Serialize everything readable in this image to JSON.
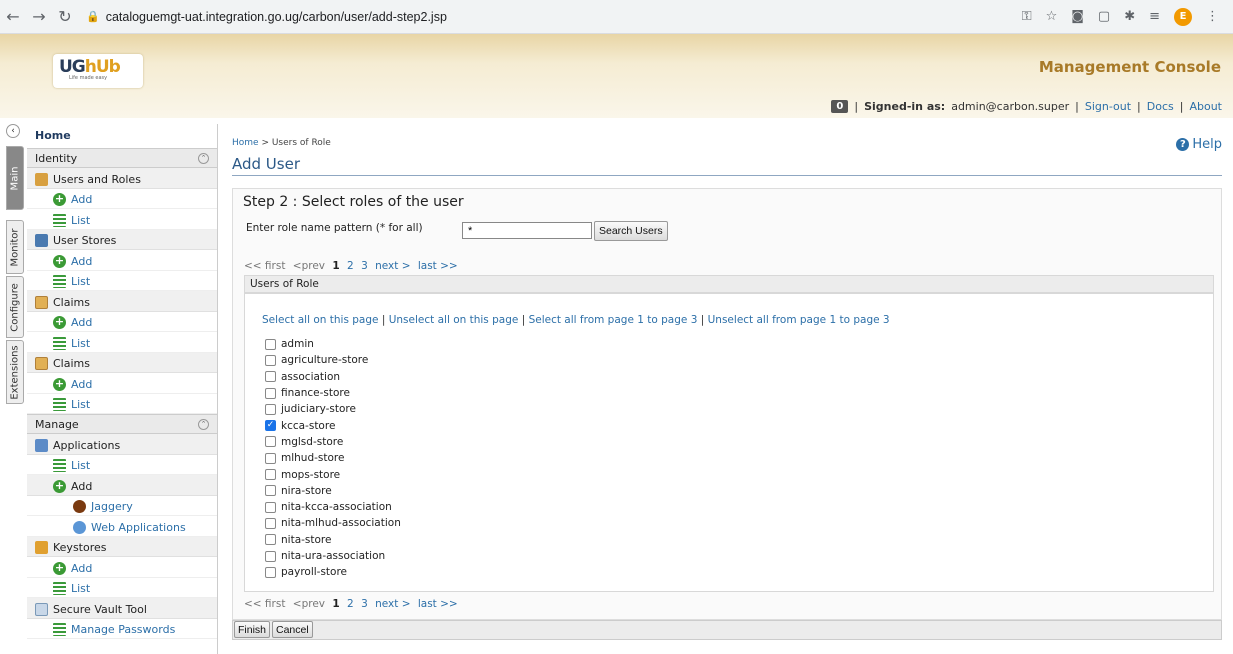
{
  "browser": {
    "url": "cataloguemgt-uat.integration.go.ug/carbon/user/add-step2.jsp",
    "profile_initial": "E"
  },
  "header": {
    "logo_text_1": "UG",
    "logo_text_2": "hUb",
    "logo_tagline": "Life made easy",
    "console_title": "Management Console",
    "notif_count": "0",
    "signed_in_label": "Signed-in as:",
    "signed_in_user": "admin@carbon.super",
    "sign_out": "Sign-out",
    "docs": "Docs",
    "about": "About"
  },
  "vtabs": [
    "Main",
    "Monitor",
    "Configure",
    "Extensions"
  ],
  "sidebar": {
    "home": "Home",
    "identity": "Identity",
    "users_and_roles": "Users and Roles",
    "add": "Add",
    "list": "List",
    "user_stores": "User Stores",
    "claims": "Claims",
    "manage": "Manage",
    "applications": "Applications",
    "jaggery": "Jaggery",
    "web_applications": "Web Applications",
    "keystores": "Keystores",
    "secure_vault_tool": "Secure Vault Tool",
    "manage_passwords": "Manage Passwords"
  },
  "main": {
    "breadcrumb_home": "Home",
    "breadcrumb_sep": " > ",
    "breadcrumb_current": "Users of Role",
    "help": "Help",
    "title": "Add User",
    "step_title": "Step 2 : Select roles of the user",
    "pattern_label": "Enter role name pattern (* for all)",
    "pattern_value": "*",
    "search_button": "Search Users",
    "pager": {
      "first": "<< first",
      "prev": "<prev",
      "pages": [
        "1",
        "2",
        "3"
      ],
      "next": "next >",
      "last": "last >>"
    },
    "roles_header": "Users of Role",
    "select_all_page": "Select all on this page",
    "unselect_all_page": "Unselect all on this page",
    "select_all_range": "Select all from page 1 to page 3",
    "unselect_all_range": "Unselect all from page 1 to page 3",
    "roles": [
      {
        "name": "admin",
        "checked": false
      },
      {
        "name": "agriculture-store",
        "checked": false
      },
      {
        "name": "association",
        "checked": false
      },
      {
        "name": "finance-store",
        "checked": false
      },
      {
        "name": "judiciary-store",
        "checked": false
      },
      {
        "name": "kcca-store",
        "checked": true
      },
      {
        "name": "mglsd-store",
        "checked": false
      },
      {
        "name": "mlhud-store",
        "checked": false
      },
      {
        "name": "mops-store",
        "checked": false
      },
      {
        "name": "nira-store",
        "checked": false
      },
      {
        "name": "nita-kcca-association",
        "checked": false
      },
      {
        "name": "nita-mlhud-association",
        "checked": false
      },
      {
        "name": "nita-store",
        "checked": false
      },
      {
        "name": "nita-ura-association",
        "checked": false
      },
      {
        "name": "payroll-store",
        "checked": false
      }
    ],
    "finish_button": "Finish",
    "cancel_button": "Cancel"
  }
}
